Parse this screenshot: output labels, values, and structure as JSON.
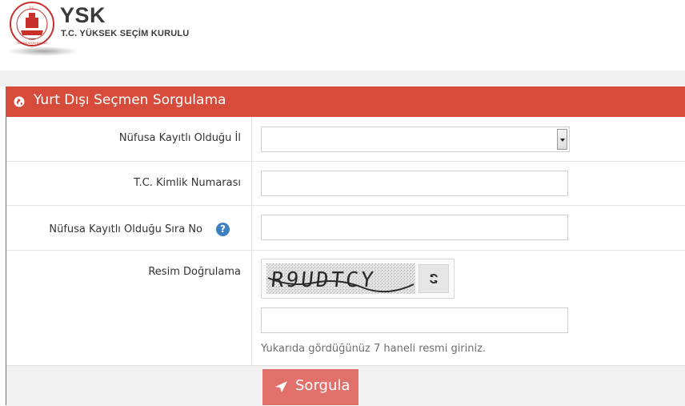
{
  "header": {
    "brand_name": "YSK",
    "brand_subtitle": "T.C. YÜKSEK SEÇİM KURULU",
    "seal_text_top": "T.C.",
    "seal_text_bottom": "YÜKSEK SEÇİM KURULU",
    "seal_year": "1950"
  },
  "panel": {
    "title": "Yurt Dışı Seçmen Sorgulama",
    "icon": "globe-icon"
  },
  "form": {
    "province_label": "Nüfusa Kayıtlı Olduğu İl",
    "province_value": "",
    "id_number_label": "T.C. Kimlik Numarası",
    "id_number_value": "",
    "sequence_label": "Nüfusa Kayıtlı Olduğu Sıra No",
    "sequence_value": "",
    "sequence_help": "?",
    "captcha_label": "Resim Doğrulama",
    "captcha_text": "R9UDTCY",
    "captcha_value": "",
    "captcha_hint": "Yukarıda gördüğünüz 7 haneli resmi giriniz.",
    "submit_label": "Sorgula"
  },
  "colors": {
    "accent": "#d64b3a",
    "button": "#e2706a",
    "help_icon": "#3d80c2"
  }
}
